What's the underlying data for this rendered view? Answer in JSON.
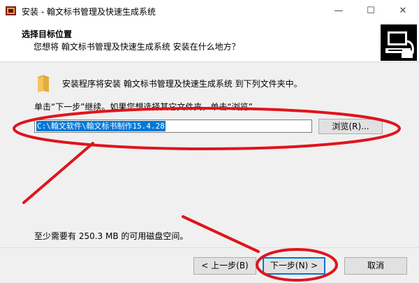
{
  "window": {
    "title": "安装 - 翰文标书管理及快速生成系统",
    "min_glyph": "—",
    "max_glyph": "☐",
    "close_glyph": "✕"
  },
  "header": {
    "title": "选择目标位置",
    "subtitle": "您想将 翰文标书管理及快速生成系统 安装在什么地方？"
  },
  "main": {
    "intro": "安装程序将安装 翰文标书管理及快速生成系统 到下列文件夹中。",
    "instruction": "单击“下一步”继续。如果您想选择其它文件夹，单击“浏览”。",
    "path_value": "C:\\翰文软件\\翰文标书制作15.4.28",
    "browse_label": "浏览(R)...",
    "space_required": "至少需要有 250.3 MB 的可用磁盘空间。"
  },
  "footer": {
    "back_label": "< 上一步(B)",
    "next_label": "下一步(N) >",
    "cancel_label": "取消"
  },
  "colors": {
    "annotation": "#e0141c",
    "selection": "#0078d7"
  }
}
